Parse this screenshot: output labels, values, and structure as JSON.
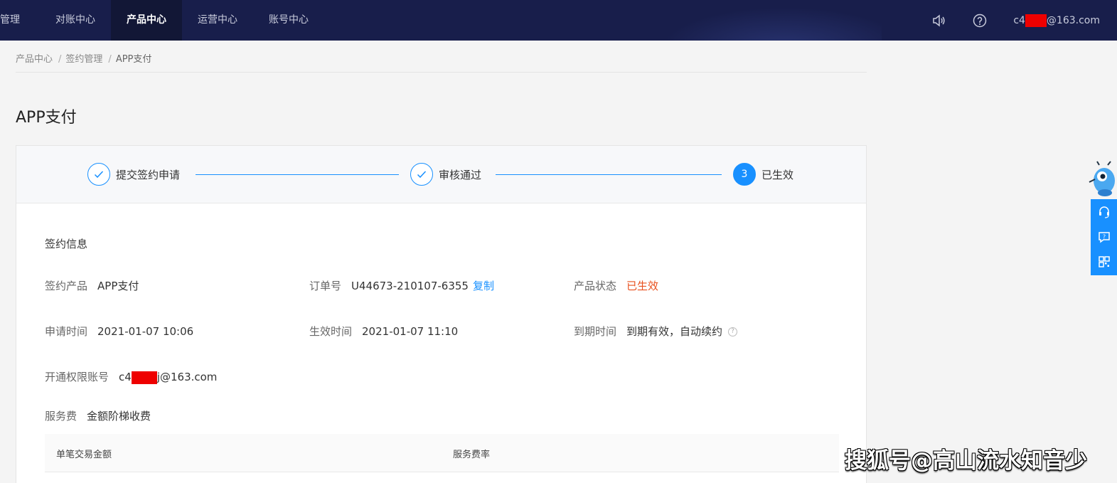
{
  "topbar": {
    "nav": [
      "金管理",
      "对账中心",
      "产品中心",
      "运营中心",
      "账号中心"
    ],
    "active_index": 2,
    "icons": [
      "speaker-icon",
      "help-icon"
    ],
    "user_prefix": "c4",
    "user_suffix": "@163.com"
  },
  "breadcrumb": {
    "items": [
      "产品中心",
      "签约管理",
      "APP支付"
    ],
    "separator": "/"
  },
  "page": {
    "title": "APP支付"
  },
  "steps": [
    {
      "label": "提交签约申请",
      "state": "done"
    },
    {
      "label": "审核通过",
      "state": "done"
    },
    {
      "label": "已生效",
      "state": "current",
      "number": "3"
    }
  ],
  "signing": {
    "section_title": "签约信息",
    "product": {
      "label": "签约产品",
      "value": "APP支付"
    },
    "order": {
      "label": "订单号",
      "value": "U44673-210107-6355",
      "copy": "复制"
    },
    "status": {
      "label": "产品状态",
      "value": "已生效"
    },
    "apply_time": {
      "label": "申请时间",
      "value": "2021-01-07 10:06"
    },
    "effective_time": {
      "label": "生效时间",
      "value": "2021-01-07 11:10"
    },
    "expire_time": {
      "label": "到期时间",
      "value": "到期有效，自动续约"
    },
    "account": {
      "label": "开通权限账号",
      "value_prefix": "c4",
      "value_suffix": "j@163.com"
    },
    "fee": {
      "label": "服务费",
      "value": "金额阶梯收费"
    }
  },
  "fee_table": {
    "headers": [
      "单笔交易金额",
      "服务费率"
    ]
  },
  "colors": {
    "topbar": "#181e4b",
    "accent": "#1890ff",
    "status": "#e8501e"
  },
  "watermark": "搜狐号@高山流水知音少"
}
